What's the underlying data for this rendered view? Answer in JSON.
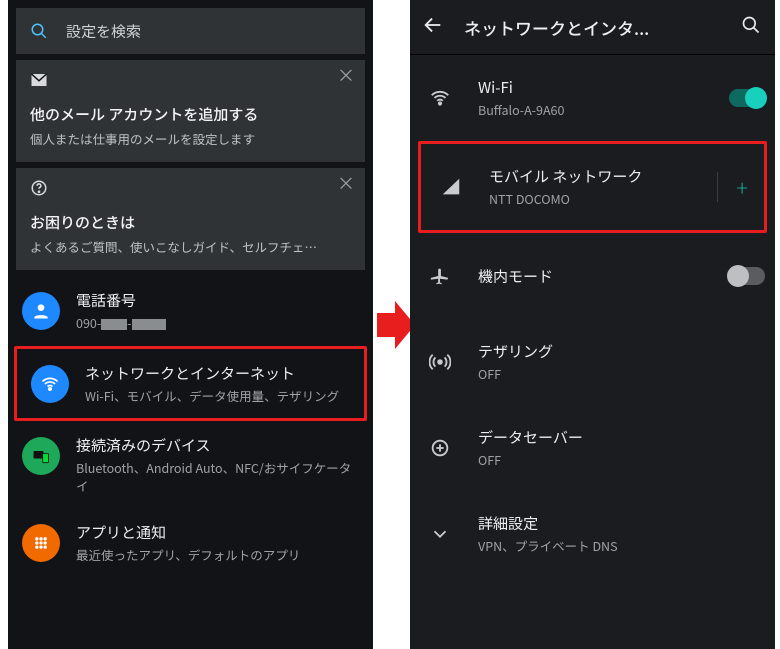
{
  "left": {
    "search_placeholder": "設定を検索",
    "card_email": {
      "title": "他のメール アカウントを追加する",
      "sub": "個人または仕事用のメールを設定します"
    },
    "card_help": {
      "title": "お困りのときは",
      "sub": "よくあるご質問、使いこなしガイド、セルフチェ…"
    },
    "rows": {
      "phone": {
        "title": "電話番号",
        "sub_prefix": "090-"
      },
      "network": {
        "title": "ネットワークとインターネット",
        "sub": "Wi-Fi、モバイル、データ使用量、テザリング"
      },
      "devices": {
        "title": "接続済みのデバイス",
        "sub": "Bluetooth、Android Auto、NFC/おサイフケータイ"
      },
      "apps": {
        "title": "アプリと通知",
        "sub": "最近使ったアプリ、デフォルトのアプリ"
      }
    }
  },
  "right": {
    "header_title": "ネットワークとインタ...",
    "items": {
      "wifi": {
        "title": "Wi-Fi",
        "sub": "Buffalo-A-9A60",
        "toggle": "on"
      },
      "mobile": {
        "title": "モバイル ネットワーク",
        "sub": "NTT DOCOMO"
      },
      "airplane": {
        "title": "機内モード",
        "toggle": "off"
      },
      "tether": {
        "title": "テザリング",
        "sub": "OFF"
      },
      "dsaver": {
        "title": "データセーバー",
        "sub": "OFF"
      },
      "advanced": {
        "title": "詳細設定",
        "sub": "VPN、プライベート DNS"
      }
    }
  }
}
